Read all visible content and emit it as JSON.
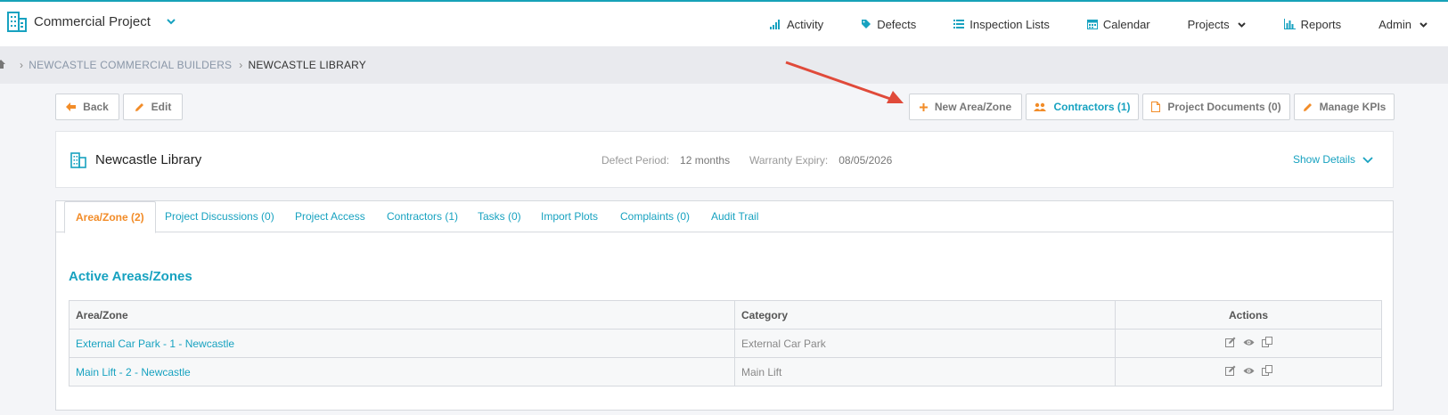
{
  "app": {
    "project_name": "Commercial Project",
    "colors": {
      "accent": "#17a2c0",
      "active_tab": "#f28c28",
      "annotation": "#e04a3a"
    }
  },
  "nav": {
    "items": [
      {
        "label": "Activity",
        "icon": "activity-icon"
      },
      {
        "label": "Defects",
        "icon": "tag-icon"
      },
      {
        "label": "Inspection Lists",
        "icon": "list-icon"
      },
      {
        "label": "Calendar",
        "icon": "calendar-icon"
      },
      {
        "label": "Projects",
        "icon": "chevron-down-icon"
      },
      {
        "label": "Reports",
        "icon": "bar-chart-icon"
      },
      {
        "label": "Admin",
        "icon": "chevron-down-icon"
      }
    ]
  },
  "breadcrumb": {
    "items": [
      "NEWCASTLE COMMERCIAL BUILDERS",
      "NEWCASTLE LIBRARY"
    ]
  },
  "toolbar": {
    "back": "Back",
    "edit": "Edit",
    "new_area": "New Area/Zone",
    "contractors": "Contractors (1)",
    "project_documents": "Project Documents (0)",
    "manage_kpis": "Manage KPIs"
  },
  "project": {
    "title": "Newcastle Library",
    "defect_period_label": "Defect Period:",
    "defect_period_value": "12 months",
    "warranty_label": "Warranty Expiry:",
    "warranty_value": "08/05/2026",
    "show_details": "Show Details"
  },
  "tabs": [
    {
      "label": "Area/Zone (2)",
      "active": true
    },
    {
      "label": "Project Discussions (0)"
    },
    {
      "label": "Project Access"
    },
    {
      "label": "Contractors (1)"
    },
    {
      "label": "Tasks (0)"
    },
    {
      "label": "Import Plots"
    },
    {
      "label": "Complaints (0)"
    },
    {
      "label": "Audit Trail"
    }
  ],
  "section": {
    "title": "Active Areas/Zones",
    "columns": [
      "Area/Zone",
      "Category",
      "Actions"
    ],
    "rows": [
      {
        "area": "External Car Park - 1 - Newcastle",
        "category": "External Car Park"
      },
      {
        "area": "Main Lift - 2 - Newcastle",
        "category": "Main Lift"
      }
    ]
  }
}
